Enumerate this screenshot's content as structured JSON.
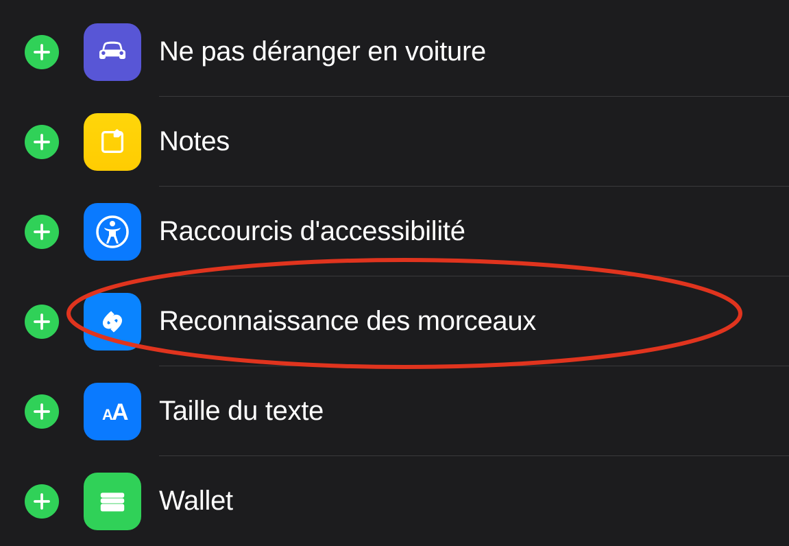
{
  "items": [
    {
      "icon": "car",
      "label": "Ne pas déranger en voiture"
    },
    {
      "icon": "notes",
      "label": "Notes"
    },
    {
      "icon": "accessibility",
      "label": "Raccourcis d'accessibilité"
    },
    {
      "icon": "shazam",
      "label": "Reconnaissance des morceaux"
    },
    {
      "icon": "textsize",
      "label": "Taille du texte"
    },
    {
      "icon": "wallet",
      "label": "Wallet"
    }
  ],
  "highlighted_index": 3
}
